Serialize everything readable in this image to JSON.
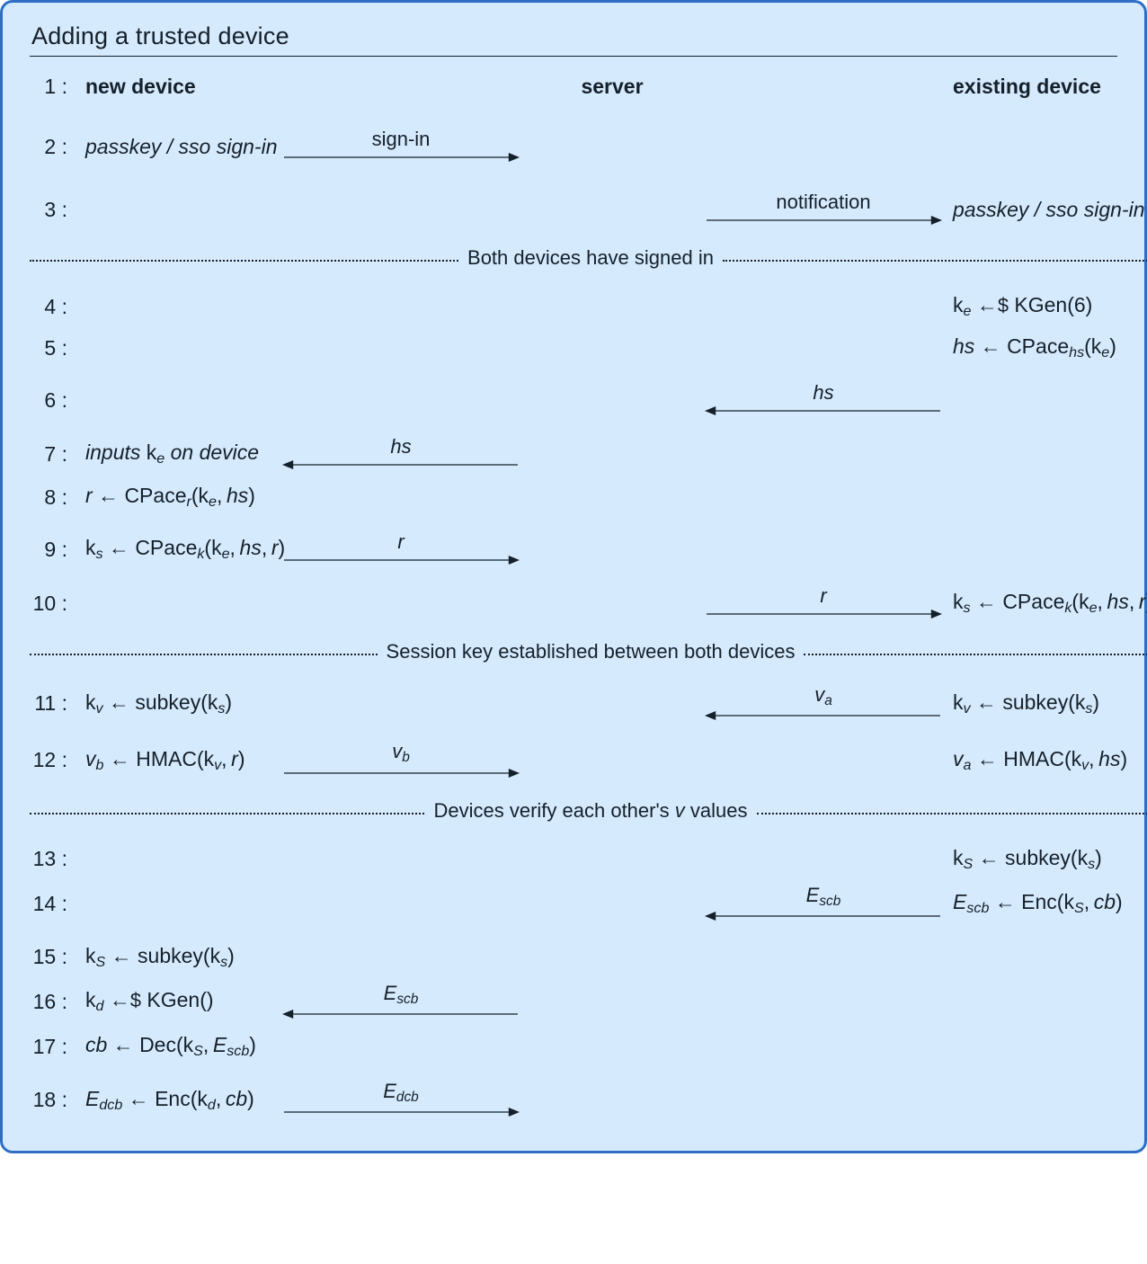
{
  "title": "Adding a trusted device",
  "columns": {
    "new_device": "new device",
    "server": "server",
    "existing_device": "existing device"
  },
  "labels": {
    "sign_in": "sign-in",
    "notification": "notification",
    "hs": "hs",
    "r": "r",
    "va": "v_a",
    "vb": "v_b",
    "Escb": "E_scb",
    "Edcb": "E_dcb"
  },
  "separators": {
    "sep1": "Both devices have signed in",
    "sep2": "Session key established between both devices",
    "sep3": "Devices verify each other's v values"
  },
  "rows": {
    "r1_num": "1",
    "r2_num": "2",
    "r2_colA": "passkey / sso sign-in",
    "r3_num": "3",
    "r3_colE": "passkey / sso sign-in",
    "r4_num": "4",
    "r4_colE": "k_e ←$ KGen(6)",
    "r5_num": "5",
    "r5_colE": "hs ← CPace_hs(k_e)",
    "r6_num": "6",
    "r7_num": "7",
    "r7_colA": "inputs k_e on device",
    "r8_num": "8",
    "r8_colA": "r ← CPace_r(k_e, hs)",
    "r9_num": "9",
    "r9_colA": "k_s ← CPace_k(k_e, hs, r)",
    "r10_num": "10",
    "r10_colE": "k_s ← CPace_k(k_e, hs, r)",
    "r11_num": "11",
    "r11_colA": "k_v ← subkey(k_s)",
    "r11_colE": "k_v ← subkey(k_s)",
    "r12_num": "12",
    "r12_colA": "v_b ← HMAC(k_v, r)",
    "r12_colE": "v_a ← HMAC(k_v, hs)",
    "r13_num": "13",
    "r13_colE": "k_S ← subkey(k_s)",
    "r14_num": "14",
    "r14_colE": "E_scb ← Enc(k_S, cb)",
    "r15_num": "15",
    "r15_colA": "k_S ← subkey(k_s)",
    "r16_num": "16",
    "r16_colA": "k_d ←$ KGen()",
    "r17_num": "17",
    "r17_colA": "cb ← Dec(k_S, E_scb)",
    "r18_num": "18",
    "r18_colA": "E_dcb ← Enc(k_d, cb)"
  }
}
